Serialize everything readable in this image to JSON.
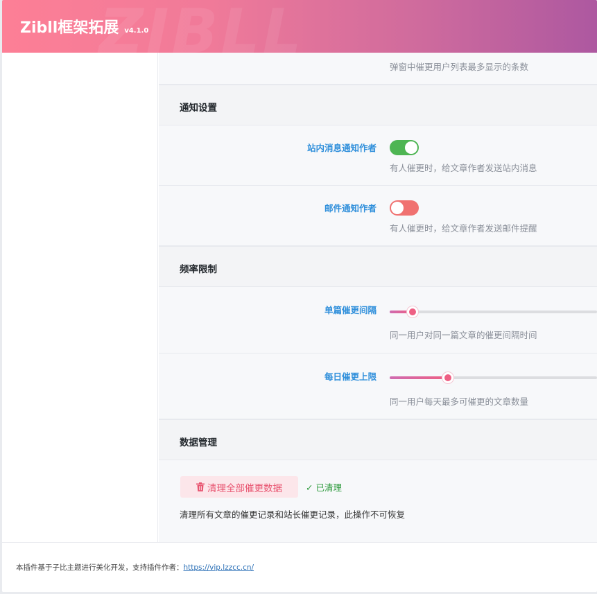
{
  "header": {
    "title": "Zibll框架拓展",
    "version": "v4.1.0",
    "watermark": "ZIBLL"
  },
  "top_partial": {
    "desc": "弹窗中催更用户列表最多显示的条数"
  },
  "sections": {
    "notify": {
      "title": "通知设置",
      "site_message": {
        "label": "站内消息通知作者",
        "state": "on",
        "desc": "有人催更时，给文章作者发送站内消息"
      },
      "email": {
        "label": "邮件通知作者",
        "state": "off",
        "desc": "有人催更时，给文章作者发送邮件提醒"
      }
    },
    "rate": {
      "title": "频率限制",
      "single_interval": {
        "label": "单篇催更间隔",
        "value_fraction": 0.11,
        "desc": "同一用户对同一篇文章的催更间隔时间"
      },
      "daily_limit": {
        "label": "每日催更上限",
        "value_fraction": 0.28,
        "desc": "同一用户每天最多可催更的文章数量"
      }
    },
    "data": {
      "title": "数据管理",
      "clear_button": "清理全部催更数据",
      "cleared_status": "✓ 已清理",
      "desc": "清理所有文章的催更记录和站长催更记录，此操作不可恢复"
    }
  },
  "footer": {
    "text": "本插件基于子比主题进行美化开发，支持插件作者：",
    "link": "https://vip.lzzcc.cn/"
  },
  "colors": {
    "accent_label": "#2f8fdb",
    "toggle_on": "#4eb553",
    "toggle_off": "#f07170",
    "slider": "#ee5f83",
    "danger": "#e85470"
  }
}
